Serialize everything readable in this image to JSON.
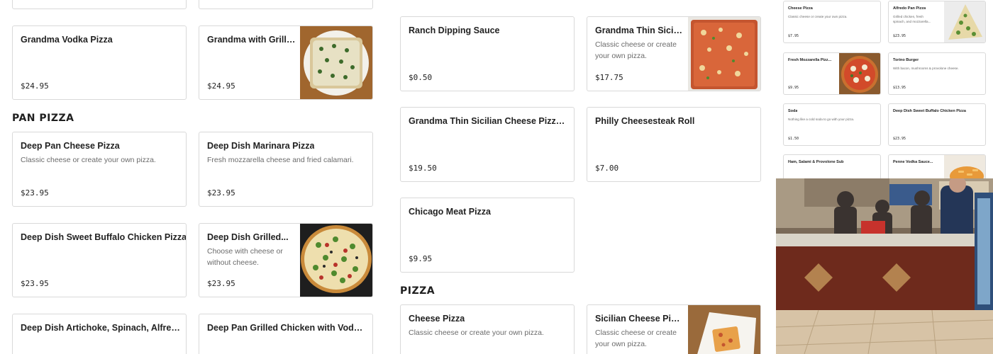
{
  "col1": {
    "items": [
      {
        "name": "Grandma Vodka Pizza",
        "price": "$24.95"
      },
      {
        "name": "Grandma with Grilled...",
        "price": "$24.95",
        "image": "grandma-grilled-pizza-photo"
      }
    ],
    "section_pan": "PAN PIZZA",
    "pan_items": [
      {
        "name": "Deep Pan Cheese Pizza",
        "desc": "Classic cheese or create your own pizza.",
        "price": "$23.95"
      },
      {
        "name": "Deep Dish Marinara Pizza",
        "desc": "Fresh mozzarella cheese and fried calamari.",
        "price": "$23.95"
      },
      {
        "name": "Deep Dish Sweet Buffalo Chicken Pizza",
        "price": "$23.95"
      },
      {
        "name": "Deep Dish Grilled...",
        "desc1": "Choose with cheese or",
        "desc2": "without cheese.",
        "price": "$23.95",
        "image": "deep-dish-grilled-pizza-photo"
      },
      {
        "name": "Deep Dish Artichoke, Spinach, Alfredo..."
      },
      {
        "name": "Deep Pan Grilled Chicken with Vodka..."
      }
    ]
  },
  "col2": {
    "items": [
      {
        "name": "Ranch Dipping Sauce",
        "price": "$0.50"
      },
      {
        "name": "Grandma Thin Sicilia...",
        "desc1": "Classic cheese or create",
        "desc2": "your own pizza.",
        "price": "$17.75",
        "image": "grandma-thin-sicilian-photo"
      },
      {
        "name": "Grandma Thin Sicilian Cheese Pizza with...",
        "price": "$19.50"
      },
      {
        "name": "Philly Cheesesteak Roll",
        "price": "$7.00"
      },
      {
        "name": "Chicago Meat Pizza",
        "price": "$9.95"
      }
    ],
    "section_pizza": "PIZZA",
    "pizza_items": [
      {
        "name": "Cheese Pizza",
        "desc": "Classic cheese or create your own pizza."
      },
      {
        "name": "Sicilian Cheese Pizza",
        "desc1": "Classic cheese or create",
        "desc2": "your own pizza.",
        "image": "sicilian-cheese-photo"
      }
    ]
  },
  "col3": {
    "items": [
      {
        "name": "Cheese Pizza",
        "desc": "Classic cheese or create your own pizza.",
        "price": "$7.95"
      },
      {
        "name": "Alfredo Pan Pizza",
        "desc1": "Grilled chicken, fresh",
        "desc2": "spinach, and mozzarella...",
        "price": "$23.95"
      },
      {
        "name": "Fresh Mozzarella Pizz...",
        "price": "$9.95"
      },
      {
        "name": "Torino Burger",
        "desc": "With bacon, mushrooms & provolone cheese.",
        "price": "$13.95"
      },
      {
        "name": "Soda",
        "desc": "Nothing like a cold soda to go with your pizza.",
        "price": "$1.50"
      },
      {
        "name": "Deep Dish Sweet Buffalo Chicken Pizza",
        "price": "$23.95"
      },
      {
        "name": "Ham, Salami & Provolone Sub"
      },
      {
        "name": "Penne Vodka Sauce..."
      }
    ]
  },
  "colors": {
    "card_border": "#d9d9d9",
    "text": "#222222",
    "muted": "#6b6b6b"
  }
}
